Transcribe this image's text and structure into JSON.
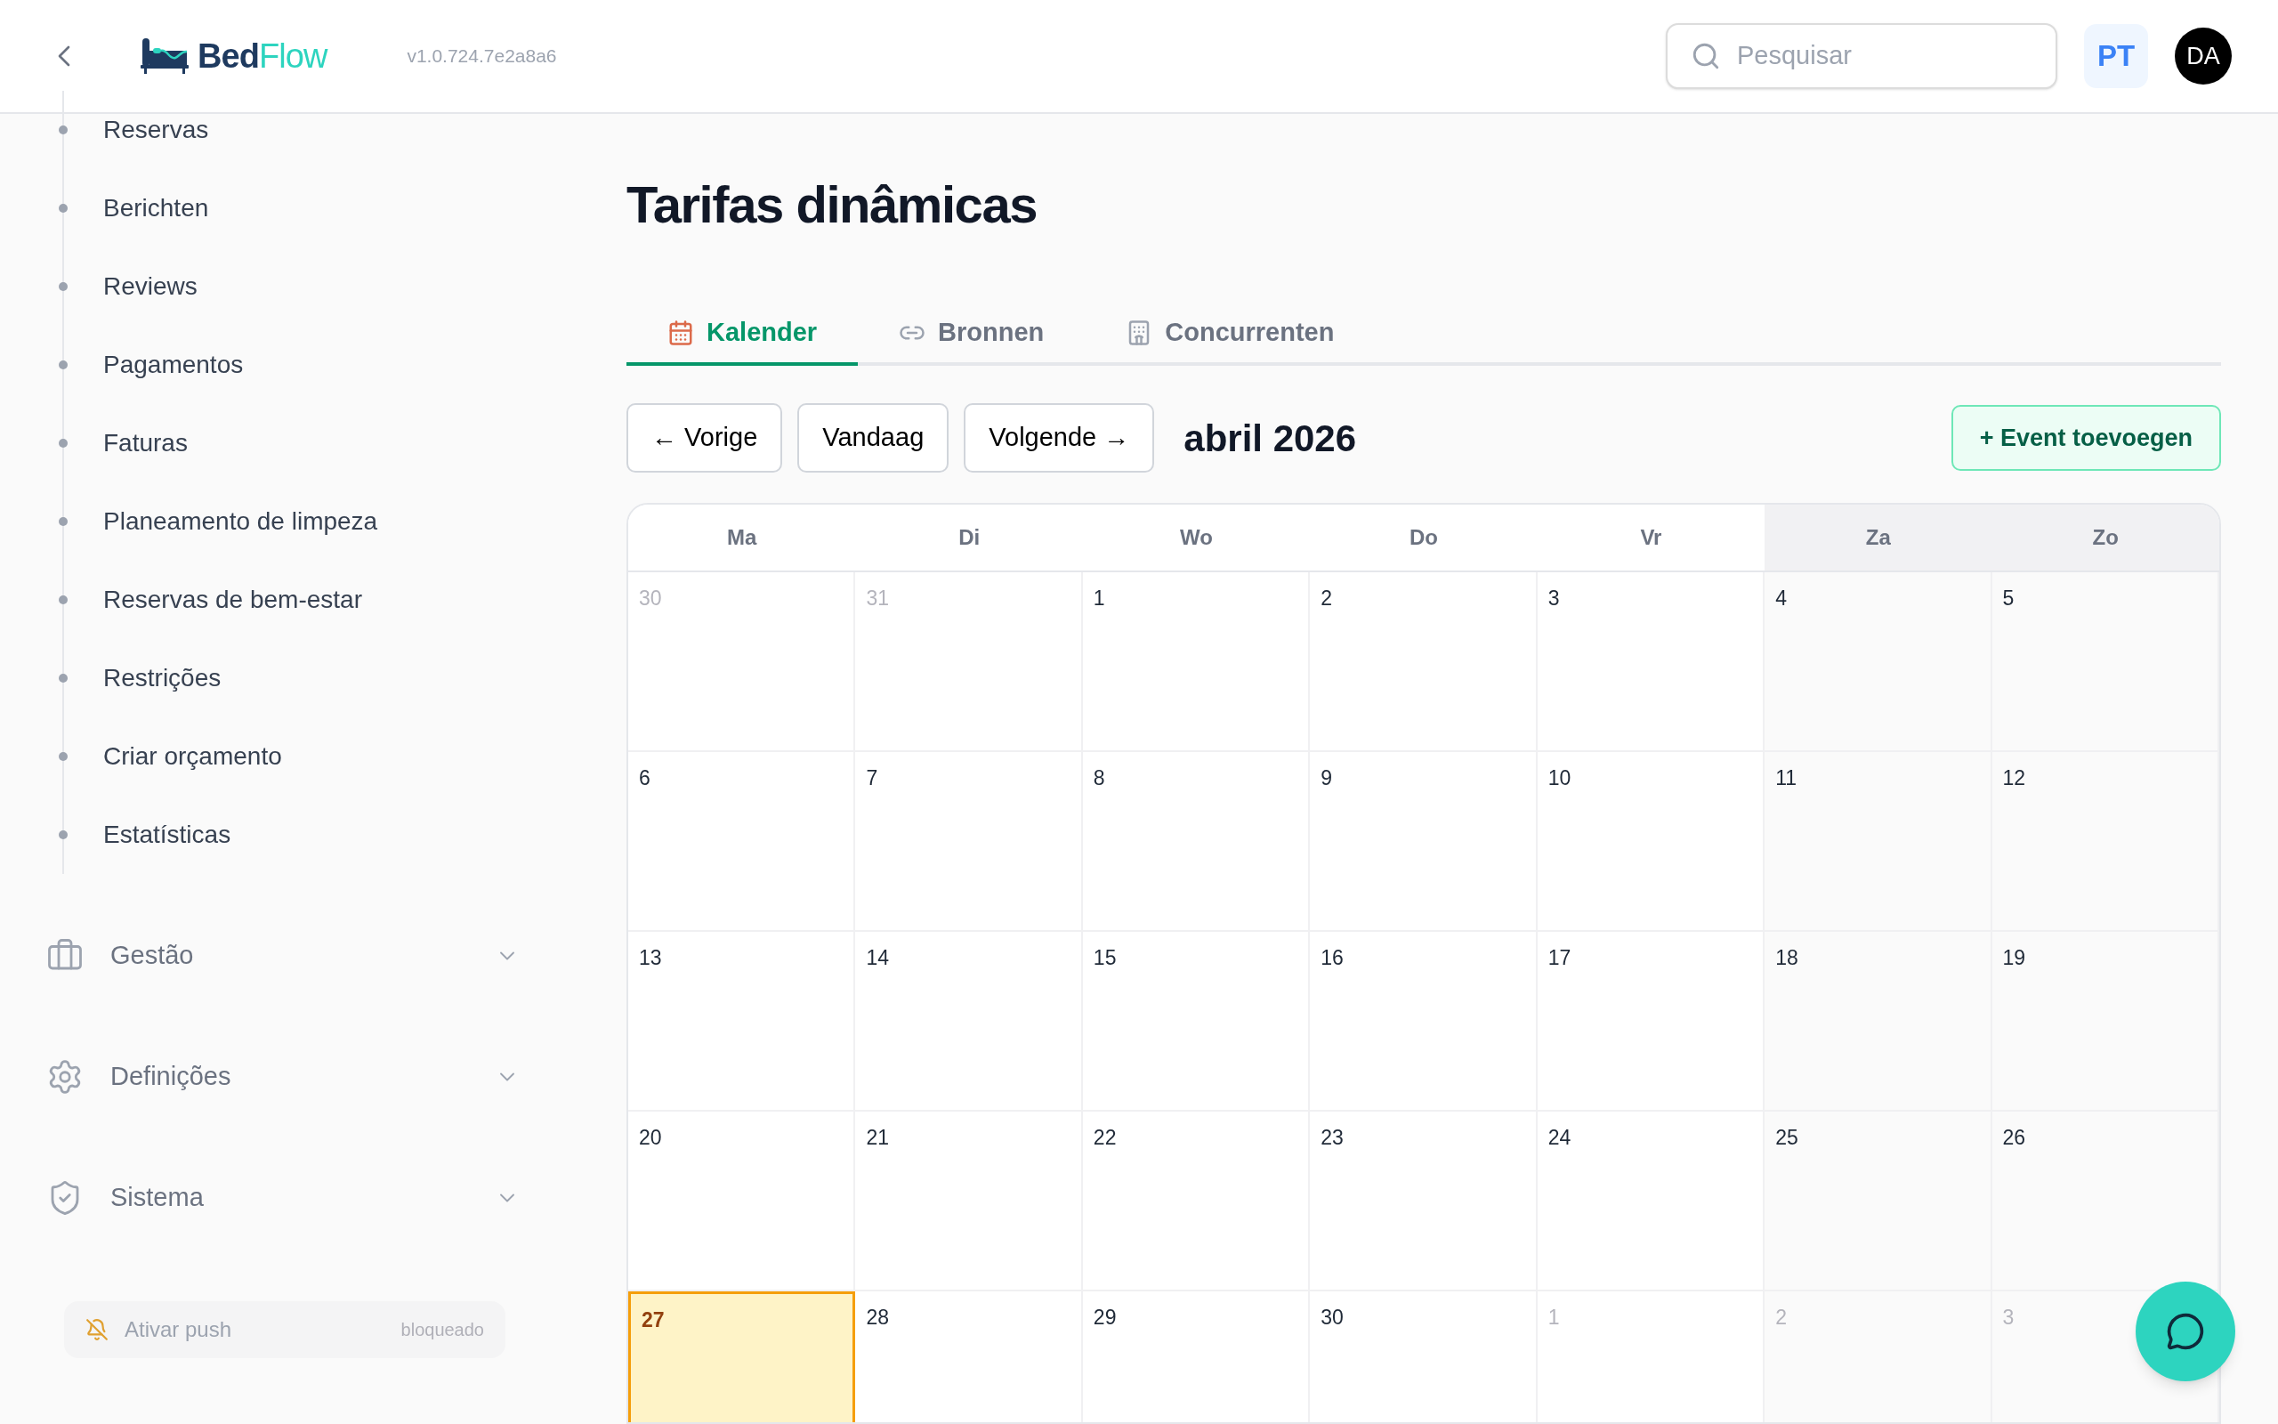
{
  "header": {
    "logo": {
      "primary": "Bed",
      "accent": "Flow"
    },
    "version": "v1.0.724.7e2a8a6",
    "search": {
      "placeholder": "Pesquisar"
    },
    "language": "PT",
    "avatar": "DA"
  },
  "sidebar": {
    "items": [
      {
        "label": "Reservas"
      },
      {
        "label": "Berichten"
      },
      {
        "label": "Reviews"
      },
      {
        "label": "Pagamentos"
      },
      {
        "label": "Faturas"
      },
      {
        "label": "Planeamento de limpeza"
      },
      {
        "label": "Reservas de bem-estar"
      },
      {
        "label": "Restrições"
      },
      {
        "label": "Criar orçamento"
      },
      {
        "label": "Estatísticas"
      }
    ],
    "groups": [
      {
        "label": "Gestão",
        "kind": "briefcase",
        "expanded": false
      },
      {
        "label": "Definições",
        "kind": "gear",
        "expanded": false
      },
      {
        "label": "Sistema",
        "kind": "shield",
        "expanded": false
      }
    ],
    "push": {
      "label": "Ativar push",
      "status": "bloqueado"
    }
  },
  "page": {
    "title": "Tarifas dinâmicas",
    "tabs": [
      {
        "label": "Kalender",
        "kind": "calendar",
        "selected": true
      },
      {
        "label": "Bronnen",
        "kind": "link",
        "selected": false
      },
      {
        "label": "Concurrenten",
        "kind": "hotel",
        "selected": false
      }
    ],
    "toolbar": {
      "previous": "← Vorige",
      "today": "Vandaag",
      "next": "Volgende →",
      "month": "abril 2026",
      "add_event": "+ Event toevoegen"
    },
    "calendar": {
      "weekdays": [
        {
          "label": "Ma",
          "weekend": false
        },
        {
          "label": "Di",
          "weekend": false
        },
        {
          "label": "Wo",
          "weekend": false
        },
        {
          "label": "Do",
          "weekend": false
        },
        {
          "label": "Vr",
          "weekend": false
        },
        {
          "label": "Za",
          "weekend": true
        },
        {
          "label": "Zo",
          "weekend": true
        }
      ],
      "weeks": [
        [
          {
            "day": "30",
            "outside": true,
            "today": false
          },
          {
            "day": "31",
            "outside": true,
            "today": false
          },
          {
            "day": "1",
            "outside": false,
            "today": false
          },
          {
            "day": "2",
            "outside": false,
            "today": false
          },
          {
            "day": "3",
            "outside": false,
            "today": false
          },
          {
            "day": "4",
            "outside": false,
            "today": false
          },
          {
            "day": "5",
            "outside": false,
            "today": false
          }
        ],
        [
          {
            "day": "6",
            "outside": false,
            "today": false
          },
          {
            "day": "7",
            "outside": false,
            "today": false
          },
          {
            "day": "8",
            "outside": false,
            "today": false
          },
          {
            "day": "9",
            "outside": false,
            "today": false
          },
          {
            "day": "10",
            "outside": false,
            "today": false
          },
          {
            "day": "11",
            "outside": false,
            "today": false
          },
          {
            "day": "12",
            "outside": false,
            "today": false
          }
        ],
        [
          {
            "day": "13",
            "outside": false,
            "today": false
          },
          {
            "day": "14",
            "outside": false,
            "today": false
          },
          {
            "day": "15",
            "outside": false,
            "today": false
          },
          {
            "day": "16",
            "outside": false,
            "today": false
          },
          {
            "day": "17",
            "outside": false,
            "today": false
          },
          {
            "day": "18",
            "outside": false,
            "today": false
          },
          {
            "day": "19",
            "outside": false,
            "today": false
          }
        ],
        [
          {
            "day": "20",
            "outside": false,
            "today": false
          },
          {
            "day": "21",
            "outside": false,
            "today": false
          },
          {
            "day": "22",
            "outside": false,
            "today": false
          },
          {
            "day": "23",
            "outside": false,
            "today": false
          },
          {
            "day": "24",
            "outside": false,
            "today": false
          },
          {
            "day": "25",
            "outside": false,
            "today": false
          },
          {
            "day": "26",
            "outside": false,
            "today": false
          }
        ],
        [
          {
            "day": "27",
            "outside": false,
            "today": true
          },
          {
            "day": "28",
            "outside": false,
            "today": false
          },
          {
            "day": "29",
            "outside": false,
            "today": false
          },
          {
            "day": "30",
            "outside": false,
            "today": false
          },
          {
            "day": "1",
            "outside": true,
            "today": false
          },
          {
            "day": "2",
            "outside": true,
            "today": false
          },
          {
            "day": "3",
            "outside": true,
            "today": false
          }
        ]
      ]
    }
  }
}
